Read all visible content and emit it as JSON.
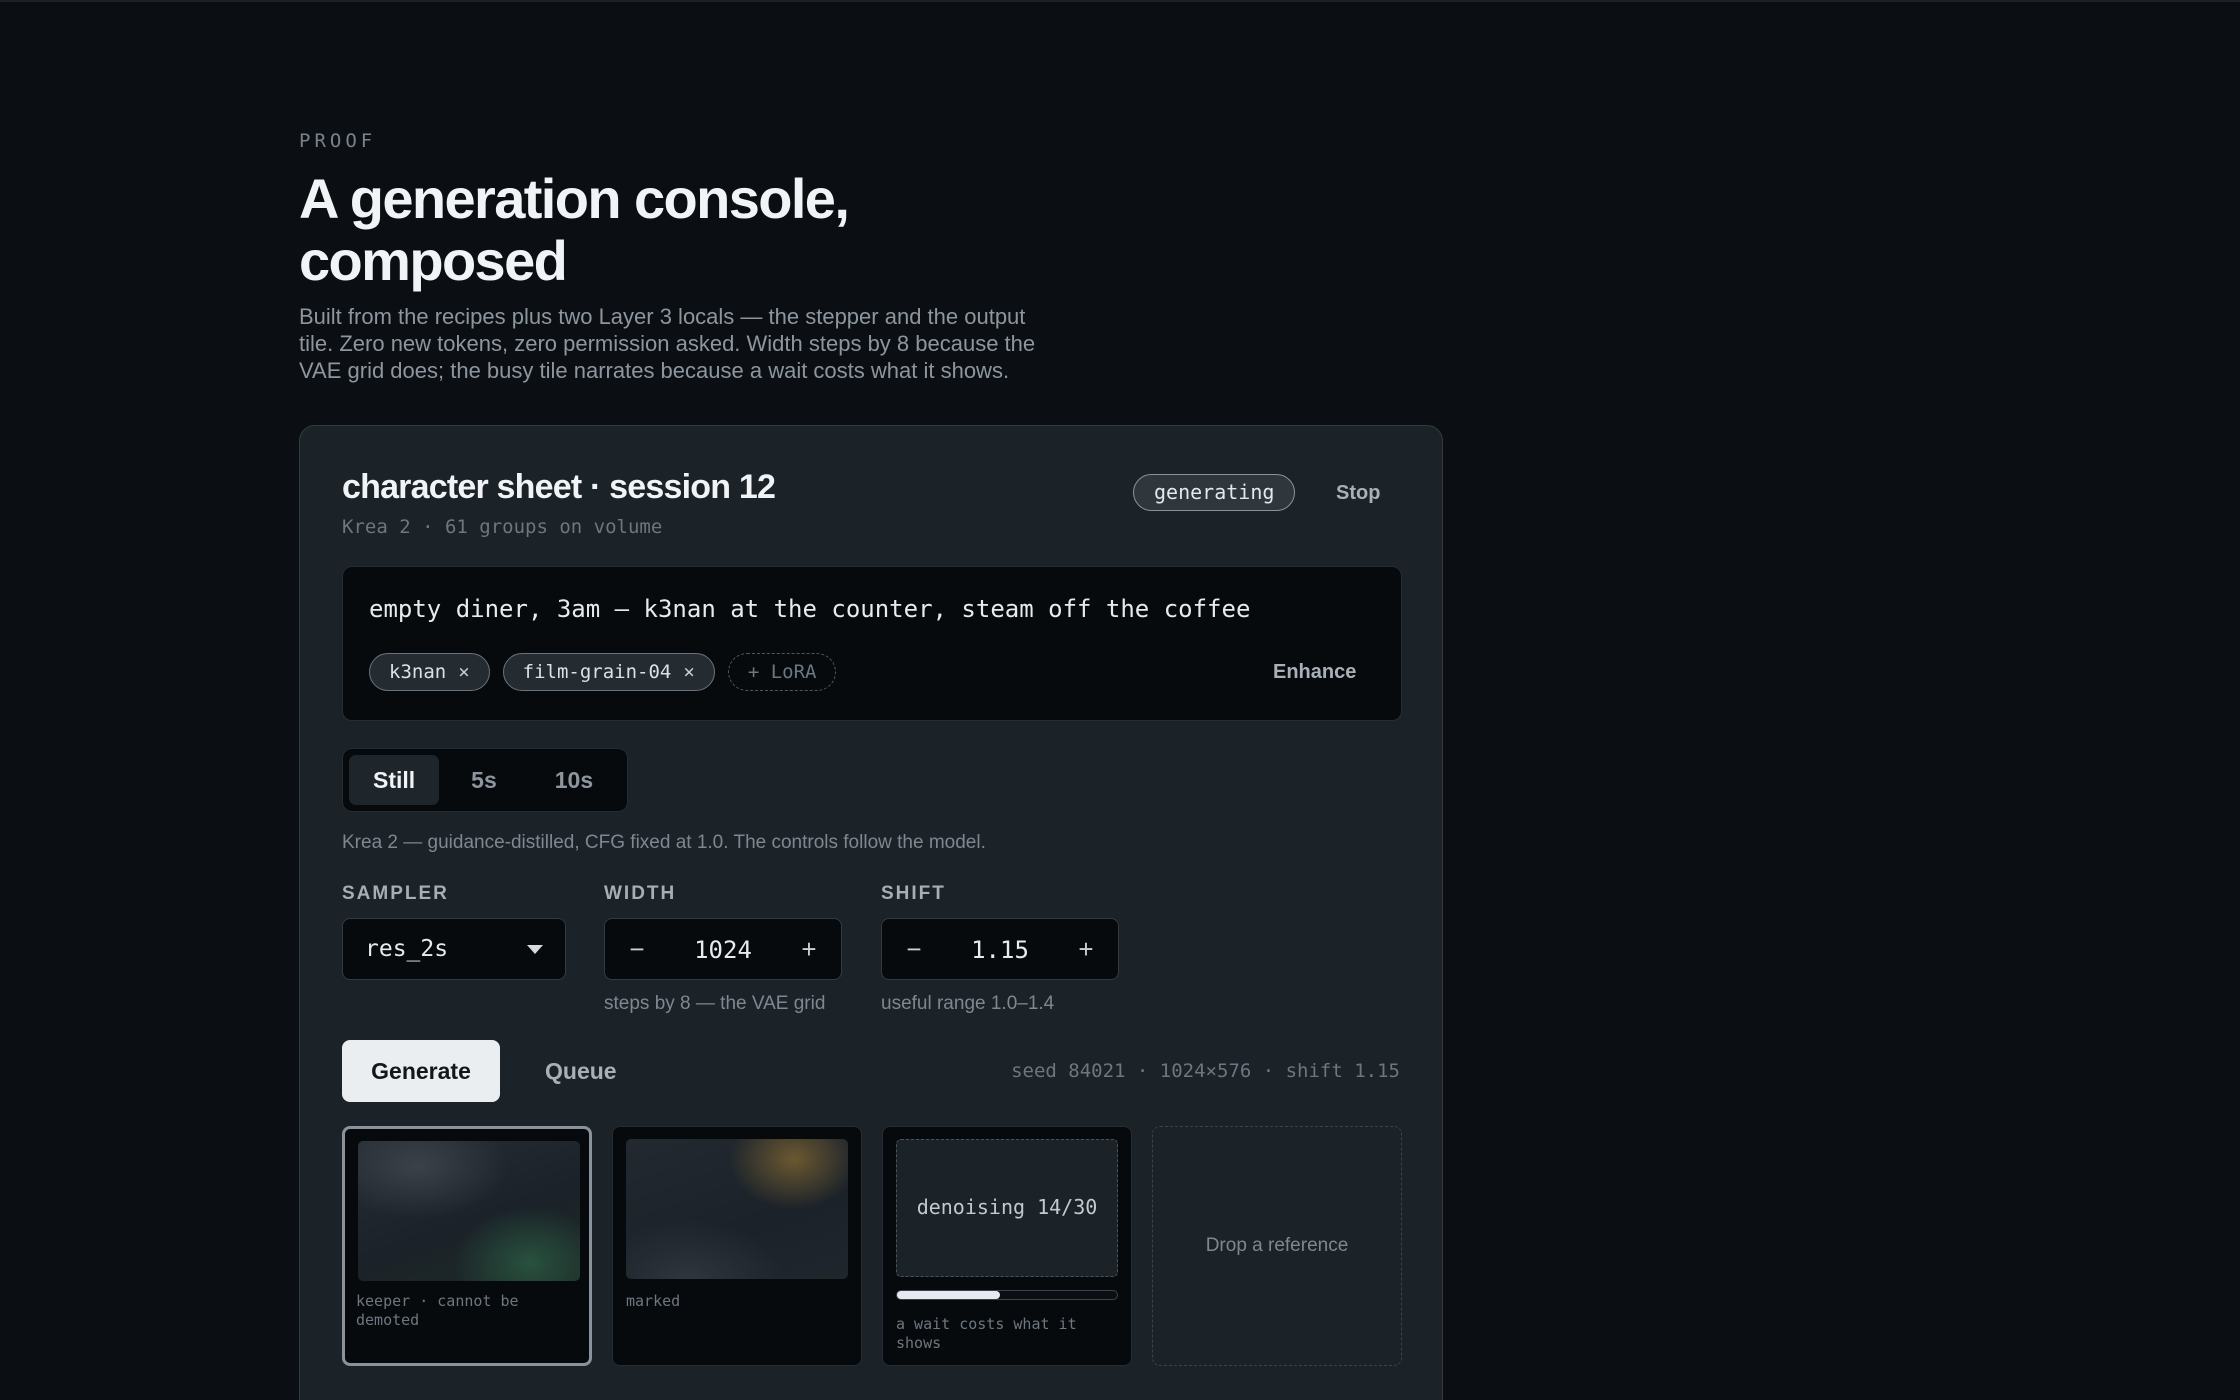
{
  "intro": {
    "eyebrow": "PROOF",
    "title": "A generation console, composed",
    "lede": "Built from the recipes plus two Layer 3 locals — the stepper and the output tile. Zero new tokens, zero permission asked. Width steps by 8 because the VAE grid does; the busy tile narrates because a wait costs what it shows."
  },
  "panel": {
    "title": "character sheet · session 12",
    "subtitle": "Krea 2 · 61 groups on volume",
    "status_badge": "generating",
    "stop_label": "Stop"
  },
  "prompt": {
    "text": "empty diner, 3am — k3nan at the counter, steam off the coffee",
    "chips": [
      {
        "label": "k3nan",
        "remove": "×"
      },
      {
        "label": "film-grain-04",
        "remove": "×"
      }
    ],
    "add_chip": "+ LoRA",
    "enhance_label": "Enhance"
  },
  "duration": {
    "options": [
      "Still",
      "5s",
      "10s"
    ],
    "selected": "Still"
  },
  "model_note": "Krea 2 — guidance-distilled, CFG fixed at 1.0. The controls follow the model.",
  "controls": {
    "sampler": {
      "label": "SAMPLER",
      "value": "res_2s"
    },
    "width": {
      "label": "WIDTH",
      "value": "1024",
      "minus": "−",
      "plus": "+",
      "helper": "steps by 8 — the VAE grid"
    },
    "shift": {
      "label": "SHIFT",
      "value": "1.15",
      "minus": "−",
      "plus": "+",
      "helper": "useful range 1.0–1.4"
    }
  },
  "actions": {
    "generate_label": "Generate",
    "queue_label": "Queue",
    "meta": "seed 84021 · 1024×576 · shift 1.15"
  },
  "tiles": {
    "keeper_caption": "keeper · cannot be demoted",
    "marked_caption": "marked",
    "busy_status": "denoising 14/30",
    "busy_progress": 0.467,
    "busy_caption": "a wait costs what it shows",
    "drop_label": "Drop a reference"
  },
  "colors": {
    "background": "#0b0f14",
    "panel": "#1b2228",
    "accent_button": "#ebeef0",
    "keeper_tint": "#2d5f46",
    "marked_tint": "#8c6e32"
  }
}
